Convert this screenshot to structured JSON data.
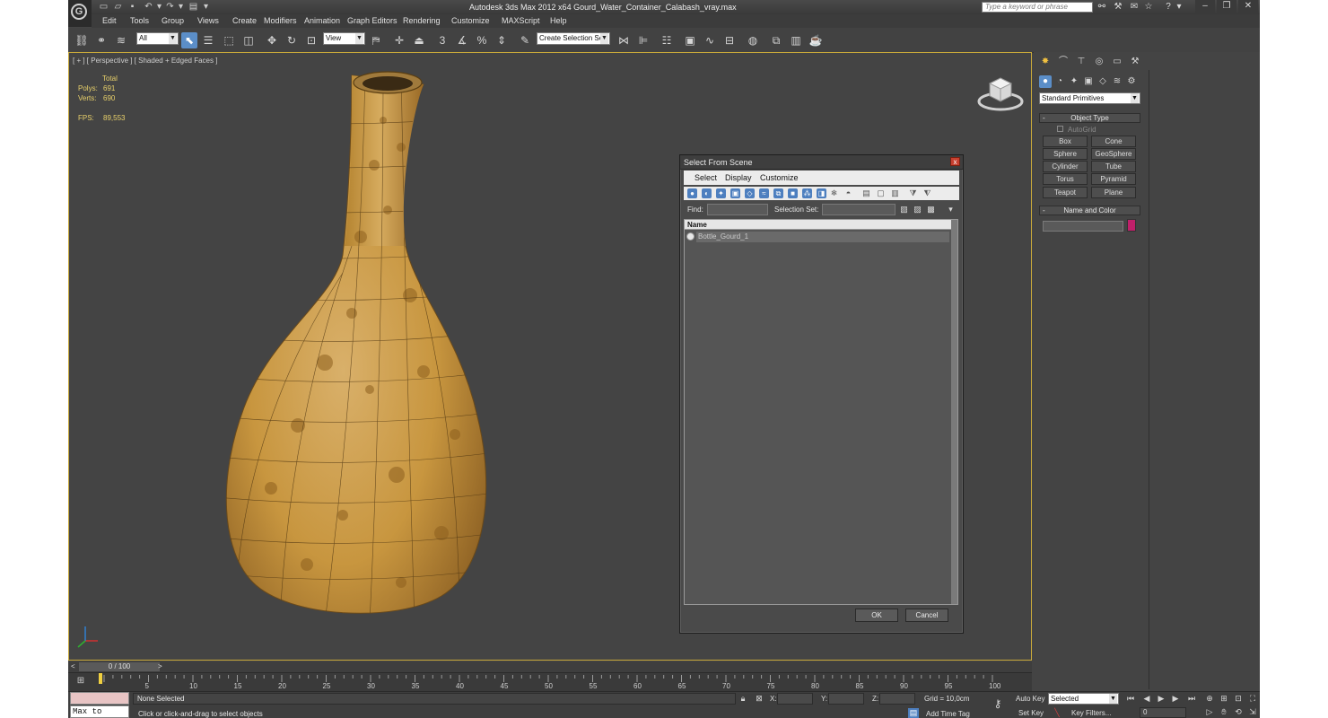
{
  "window": {
    "title": "Autodesk 3ds Max  2012 x64     Gourd_Water_Container_Calabash_vray.max",
    "search_placeholder": "Type a keyword or phrase"
  },
  "menu": [
    "Edit",
    "Tools",
    "Group",
    "Views",
    "Create",
    "Modifiers",
    "Animation",
    "Graph Editors",
    "Rendering",
    "Customize",
    "MAXScript",
    "Help"
  ],
  "toolbar": {
    "filter_value": "All",
    "refcoord_value": "View",
    "selection_set_placeholder": "Create Selection Se",
    "snap_label": "3"
  },
  "viewport": {
    "label": "[ + ] [ Perspective ] [ Shaded + Edged Faces ]",
    "stats": {
      "total_label": "Total",
      "polys_label": "Polys:",
      "polys_value": "691",
      "verts_label": "Verts:",
      "verts_value": "690",
      "fps_label": "FPS:",
      "fps_value": "89,553"
    }
  },
  "dialog": {
    "title": "Select From Scene",
    "close_label": "x",
    "menu": [
      "Select",
      "Display",
      "Customize"
    ],
    "find_label": "Find:",
    "selection_set_label": "Selection Set:",
    "column_name": "Name",
    "objects": [
      "Bottle_Gourd_1"
    ],
    "ok_label": "OK",
    "cancel_label": "Cancel"
  },
  "command_panel": {
    "primitive_type": "Standard Primitives",
    "object_type_header": "Object Type",
    "autogrid_label": "AutoGrid",
    "buttons": [
      "Box",
      "Cone",
      "Sphere",
      "GeoSphere",
      "Cylinder",
      "Tube",
      "Torus",
      "Pyramid",
      "Teapot",
      "Plane"
    ],
    "name_color_header": "Name and Color",
    "object_color": "#c0206a"
  },
  "timeline": {
    "slider_value": "0 / 100",
    "ticks": [
      "5",
      "10",
      "15",
      "20",
      "25",
      "30",
      "35",
      "40",
      "45",
      "50",
      "55",
      "60",
      "65",
      "70",
      "75",
      "80",
      "85",
      "90",
      "95",
      "100"
    ]
  },
  "status": {
    "maxscript_listener": "Max to Physc",
    "selection_status": "None Selected",
    "prompt": "Click or click-and-drag to select objects",
    "x_label": "X:",
    "y_label": "Y:",
    "z_label": "Z:",
    "grid": "Grid = 10,0cm",
    "add_time_tag": "Add Time Tag",
    "auto_key": "Auto Key",
    "set_key": "Set Key",
    "selected_value": "Selected",
    "key_filters": "Key Filters...",
    "frame_value": "0"
  },
  "colors": {
    "viewport_border": "#c9a93a",
    "stats_text": "#e8d06a",
    "highlight": "#5b8ec8"
  }
}
